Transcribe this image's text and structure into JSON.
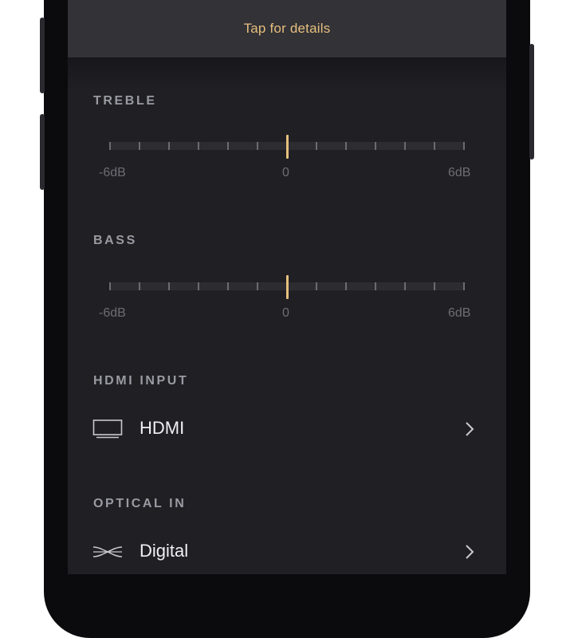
{
  "header": {
    "details_text": "Tap for details"
  },
  "eq": {
    "treble": {
      "label": "TREBLE",
      "min_label": "-6dB",
      "mid_label": "0",
      "max_label": "6dB",
      "value_db": 0,
      "range_db": [
        -6,
        6
      ]
    },
    "bass": {
      "label": "BASS",
      "min_label": "-6dB",
      "mid_label": "0",
      "max_label": "6dB",
      "value_db": 0,
      "range_db": [
        -6,
        6
      ]
    }
  },
  "hdmi": {
    "section_label": "HDMI INPUT",
    "value": "HDMI",
    "icon": "tv-icon"
  },
  "optical": {
    "section_label": "OPTICAL IN",
    "value": "Digital",
    "icon": "optical-cable-icon"
  },
  "colors": {
    "accent": "#e7bf7d",
    "background": "#1f1f24",
    "details_bar": "#323237"
  }
}
